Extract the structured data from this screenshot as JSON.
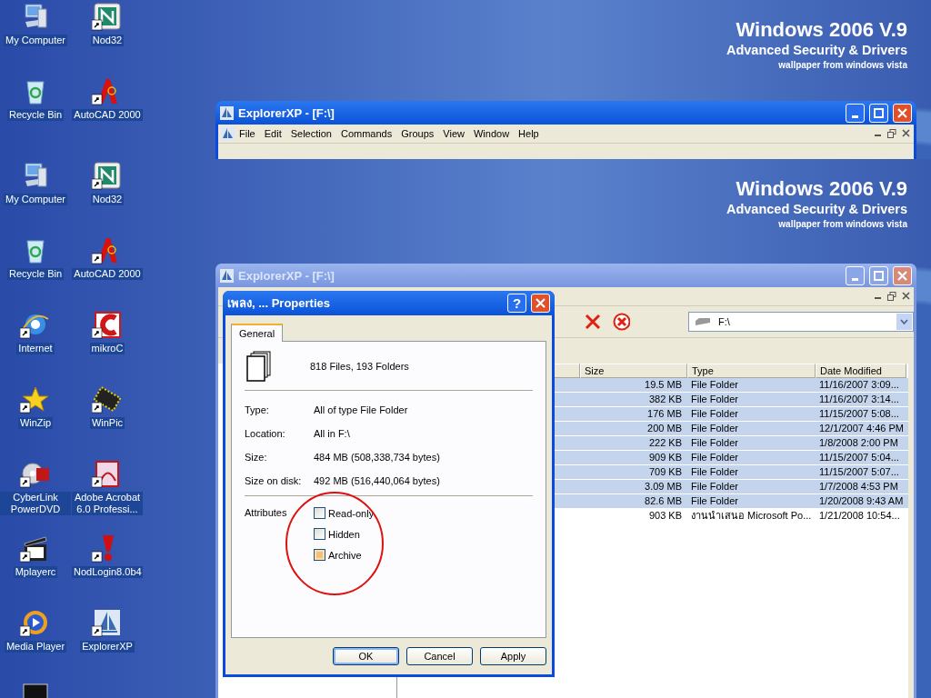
{
  "screens": [
    {
      "wallpaper": {
        "title": "Windows 2006 V.9",
        "subtitle": "Advanced Security & Drivers",
        "credit": "wallpaper from windows vista"
      },
      "desktop_icons": [
        {
          "label": "My Computer",
          "shortcut": false
        },
        {
          "label": "Nod32",
          "shortcut": true
        },
        {
          "label": "Recycle Bin",
          "shortcut": false
        },
        {
          "label": "AutoCAD 2000",
          "shortcut": true
        }
      ],
      "window": {
        "title": "ExplorerXP - [F:\\]",
        "active": true,
        "menus": [
          "File",
          "Edit",
          "Selection",
          "Commands",
          "Groups",
          "View",
          "Window",
          "Help"
        ]
      }
    },
    {
      "wallpaper": {
        "title": "Windows 2006 V.9",
        "subtitle": "Advanced Security & Drivers",
        "credit": "wallpaper from windows vista"
      },
      "desktop_icons": [
        {
          "kind": "labeled",
          "label": "My Computer",
          "shortcut": false
        },
        {
          "kind": "labeled",
          "label": "Nod32",
          "shortcut": true
        },
        {
          "kind": "labeled",
          "label": "Recycle Bin",
          "shortcut": false
        },
        {
          "kind": "labeled",
          "label": "AutoCAD 2000",
          "shortcut": true
        },
        {
          "kind": "labeled",
          "label": "Internet",
          "shortcut": true
        },
        {
          "kind": "labeled",
          "label": "mikroC",
          "shortcut": true
        },
        {
          "kind": "labeled",
          "label": "WinZip",
          "shortcut": true
        },
        {
          "kind": "labeled",
          "label": "WinPic",
          "shortcut": true
        },
        {
          "kind": "labeled",
          "label": "CyberLink PowerDVD",
          "shortcut": true
        },
        {
          "kind": "labeled",
          "label": "Adobe Acrobat 6.0 Professi...",
          "shortcut": true
        },
        {
          "kind": "labeled",
          "label": "Mplayerc",
          "shortcut": true
        },
        {
          "kind": "labeled",
          "label": "NodLogin8.0b4",
          "shortcut": true
        },
        {
          "kind": "labeled",
          "label": "Media Player",
          "shortcut": true
        },
        {
          "kind": "labeled",
          "label": "ExplorerXP",
          "shortcut": true
        },
        {
          "kind": "cut"
        }
      ],
      "window": {
        "title": "ExplorerXP - [F:\\]",
        "active": false,
        "address": "F:\\",
        "columns": [
          "Size",
          "Type",
          "Date Modified"
        ],
        "rows": [
          {
            "size": "19.5 MB",
            "type": "File Folder",
            "date": "11/16/2007 3:09...",
            "selected": true
          },
          {
            "size": "382 KB",
            "type": "File Folder",
            "date": "11/16/2007 3:14...",
            "selected": true
          },
          {
            "size": "176 MB",
            "type": "File Folder",
            "date": "11/15/2007 5:08...",
            "selected": true
          },
          {
            "size": "200 MB",
            "type": "File Folder",
            "date": "12/1/2007 4:46 PM",
            "selected": true
          },
          {
            "size": "222 KB",
            "type": "File Folder",
            "date": "1/8/2008 2:00 PM",
            "selected": true
          },
          {
            "size": "909 KB",
            "type": "File Folder",
            "date": "11/15/2007 5:04...",
            "selected": true
          },
          {
            "size": "709 KB",
            "type": "File Folder",
            "date": "11/15/2007 5:07...",
            "selected": true
          },
          {
            "size": "3.09 MB",
            "type": "File Folder",
            "date": "1/7/2008 4:53 PM",
            "selected": true
          },
          {
            "size": "82.6 MB",
            "type": "File Folder",
            "date": "1/20/2008 9:43 AM",
            "selected": true
          },
          {
            "size": "903 KB",
            "type": "งานนำเสนอ Microsoft Po...",
            "date": "1/21/2008 10:54...",
            "selected": false
          }
        ]
      },
      "dialog": {
        "title": "เพลง, ... Properties",
        "help": "?",
        "active": true,
        "tabs": [
          {
            "label": "General",
            "selected": true
          }
        ],
        "summary": "818 Files, 193 Folders",
        "fields": [
          {
            "label": "Type:",
            "value": "All of type File Folder"
          },
          {
            "label": "Location:",
            "value": "All in F:\\"
          },
          {
            "label": "Size:",
            "value": "484 MB (508,338,734 bytes)"
          },
          {
            "label": "Size on disk:",
            "value": "492 MB (516,440,064 bytes)"
          }
        ],
        "attributes_label": "Attributes",
        "attributes": [
          {
            "label": "Read-only",
            "checked": false,
            "indeterminate": false
          },
          {
            "label": "Hidden",
            "checked": false,
            "indeterminate": false
          },
          {
            "label": "Archive",
            "checked": false,
            "indeterminate": true
          }
        ],
        "buttons": [
          {
            "label": "OK",
            "default": true
          },
          {
            "label": "Cancel",
            "default": false
          },
          {
            "label": "Apply",
            "default": false
          }
        ]
      }
    }
  ]
}
